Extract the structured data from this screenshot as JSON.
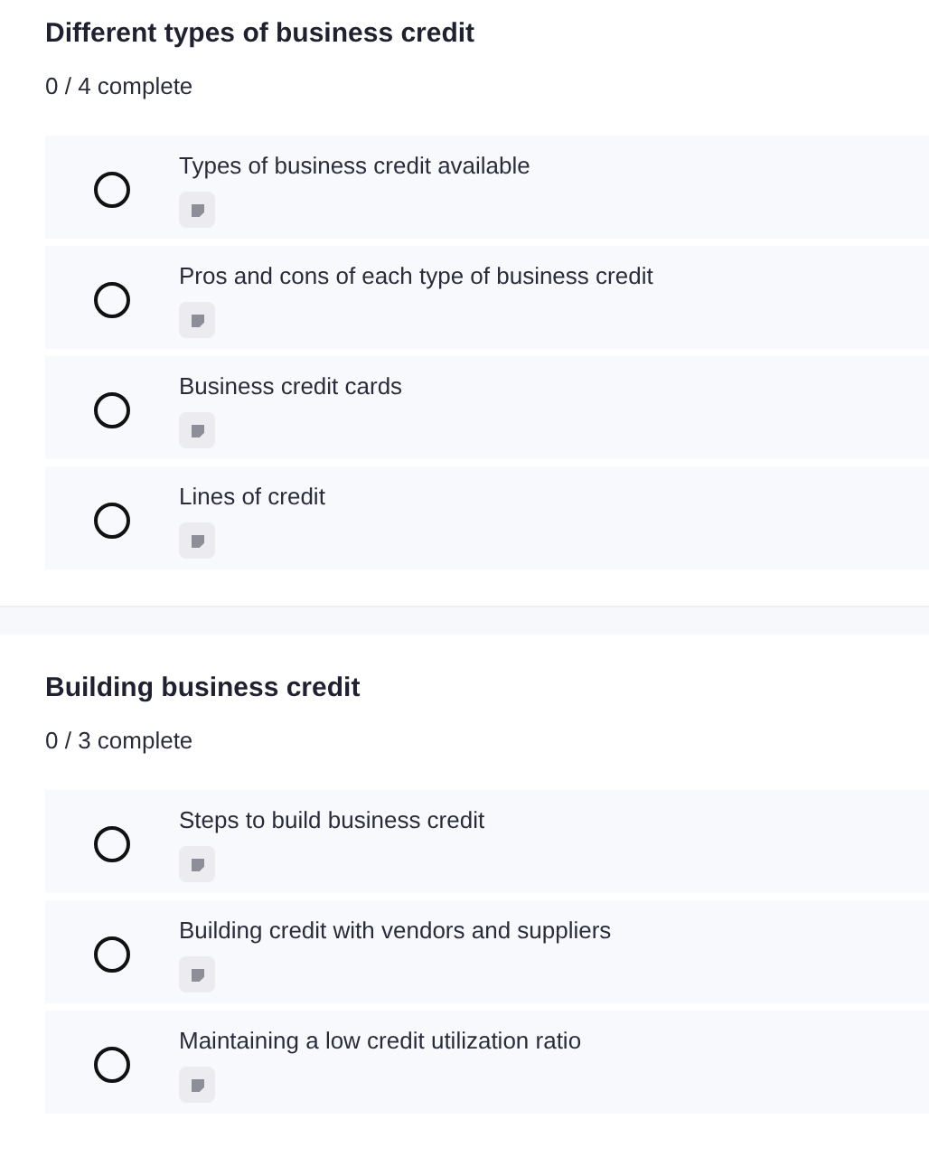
{
  "sections": [
    {
      "title": "Different types of business credit",
      "progress": "0 / 4 complete",
      "lessons": [
        {
          "title": "Types of business credit available",
          "completed": false
        },
        {
          "title": "Pros and cons of each type of business credit",
          "completed": false
        },
        {
          "title": "Business credit cards",
          "completed": false
        },
        {
          "title": "Lines of credit",
          "completed": false
        }
      ]
    },
    {
      "title": "Building business credit",
      "progress": "0 / 3 complete",
      "lessons": [
        {
          "title": "Steps to build business credit",
          "completed": false
        },
        {
          "title": "Building credit with vendors and suppliers",
          "completed": false
        },
        {
          "title": "Maintaining a low credit utilization ratio",
          "completed": false
        }
      ]
    }
  ]
}
